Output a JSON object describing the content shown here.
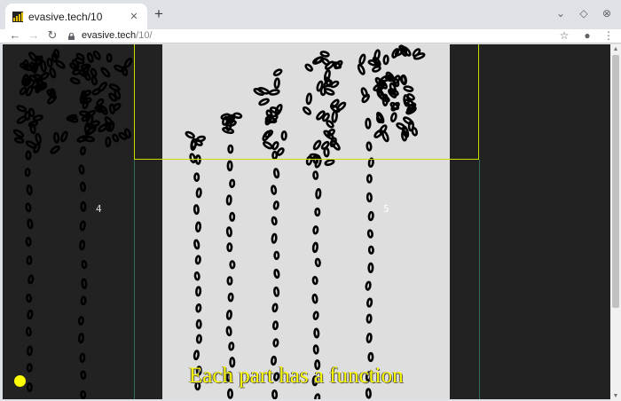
{
  "browser": {
    "tab": {
      "title": "evasive.tech/10",
      "close_glyph": "✕"
    },
    "new_tab_glyph": "+",
    "window_controls": {
      "minimize": "⌄",
      "restore": "◇",
      "close": "⊗"
    },
    "nav": {
      "back": "←",
      "forward": "→",
      "reload": "↻"
    },
    "url": {
      "host": "evasive.tech",
      "path": "/10/"
    },
    "toolbar_icons": {
      "bookmark": "☆",
      "profile": "●",
      "menu": "⋮"
    }
  },
  "page": {
    "label_left": "4",
    "label_right": "5",
    "caption": "Each part has a function",
    "colors": {
      "background": "#222222",
      "panel": "#dedede",
      "highlight_box": "#c8e000",
      "caption": "#ffff00",
      "indicator_dot": "#ffff00",
      "left_label": "#dddddd",
      "right_label": "#ffffff"
    }
  }
}
